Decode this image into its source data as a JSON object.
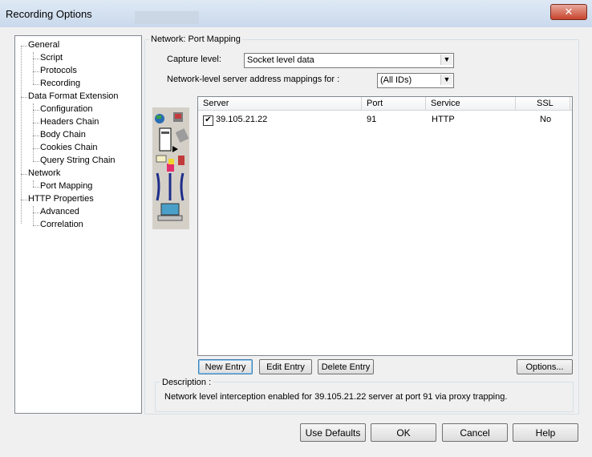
{
  "window": {
    "title": "Recording Options",
    "close_glyph": "✕"
  },
  "tree": {
    "items": [
      {
        "label": "General",
        "level": 0
      },
      {
        "label": "Script",
        "level": 1
      },
      {
        "label": "Protocols",
        "level": 1
      },
      {
        "label": "Recording",
        "level": 1
      },
      {
        "label": "Data Format Extension",
        "level": 0
      },
      {
        "label": "Configuration",
        "level": 1
      },
      {
        "label": "Headers Chain",
        "level": 1
      },
      {
        "label": "Body Chain",
        "level": 1
      },
      {
        "label": "Cookies Chain",
        "level": 1
      },
      {
        "label": "Query String Chain",
        "level": 1
      },
      {
        "label": "Network",
        "level": 0
      },
      {
        "label": "Port Mapping",
        "level": 1
      },
      {
        "label": "HTTP Properties",
        "level": 0
      },
      {
        "label": "Advanced",
        "level": 1
      },
      {
        "label": "Correlation",
        "level": 1
      }
    ]
  },
  "panel": {
    "title": "Network: Port Mapping",
    "capture_level_label": "Capture level:",
    "capture_level_value": "Socket level data",
    "mappings_label": "Network-level server address mappings for :",
    "mappings_value": "(All IDs)"
  },
  "table": {
    "columns": [
      "Server",
      "Port",
      "Service",
      "SSL"
    ],
    "rows": [
      {
        "checked": true,
        "server": "39.105.21.22",
        "port": "91",
        "service": "HTTP",
        "ssl": "No"
      }
    ]
  },
  "buttons": {
    "new_entry": "New Entry",
    "edit_entry": "Edit Entry",
    "delete_entry": "Delete Entry",
    "options": "Options...",
    "use_defaults": "Use Defaults",
    "ok": "OK",
    "cancel": "Cancel",
    "help": "Help"
  },
  "description": {
    "label": "Description :",
    "text": "Network level interception enabled for 39.105.21.22 server at port 91 via proxy trapping."
  },
  "icons": {
    "combo_arrow": "chevron-down-icon",
    "checkbox": "checkmark-icon",
    "panel_art": "network-topology-icon"
  }
}
